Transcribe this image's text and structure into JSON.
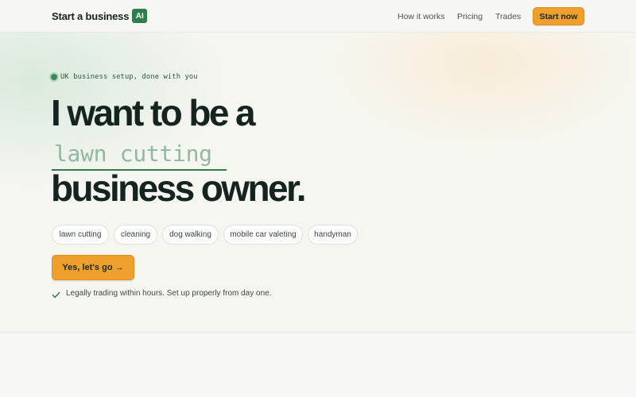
{
  "header": {
    "logo_text": "Start a business",
    "logo_badge": "AI",
    "nav": {
      "how_it_works": "How it works",
      "pricing": "Pricing",
      "trades": "Trades"
    },
    "start_now": "Start now"
  },
  "hero": {
    "eyebrow": "UK business setup, done with you",
    "headline_line1": "I want to be a",
    "typed_value": "lawn cutting",
    "headline_line2": "business owner.",
    "chips": [
      "lawn cutting",
      "cleaning",
      "dog walking",
      "mobile car valeting",
      "handyman"
    ],
    "cta": "Yes, let's go →",
    "reassurance": "Legally trading within hours. Set up properly from day one."
  },
  "colors": {
    "accent_green": "#2f7d4f",
    "cta_orange": "#ef9f2c",
    "text_dark": "#15241c"
  },
  "icons": {
    "check": "check-icon"
  }
}
